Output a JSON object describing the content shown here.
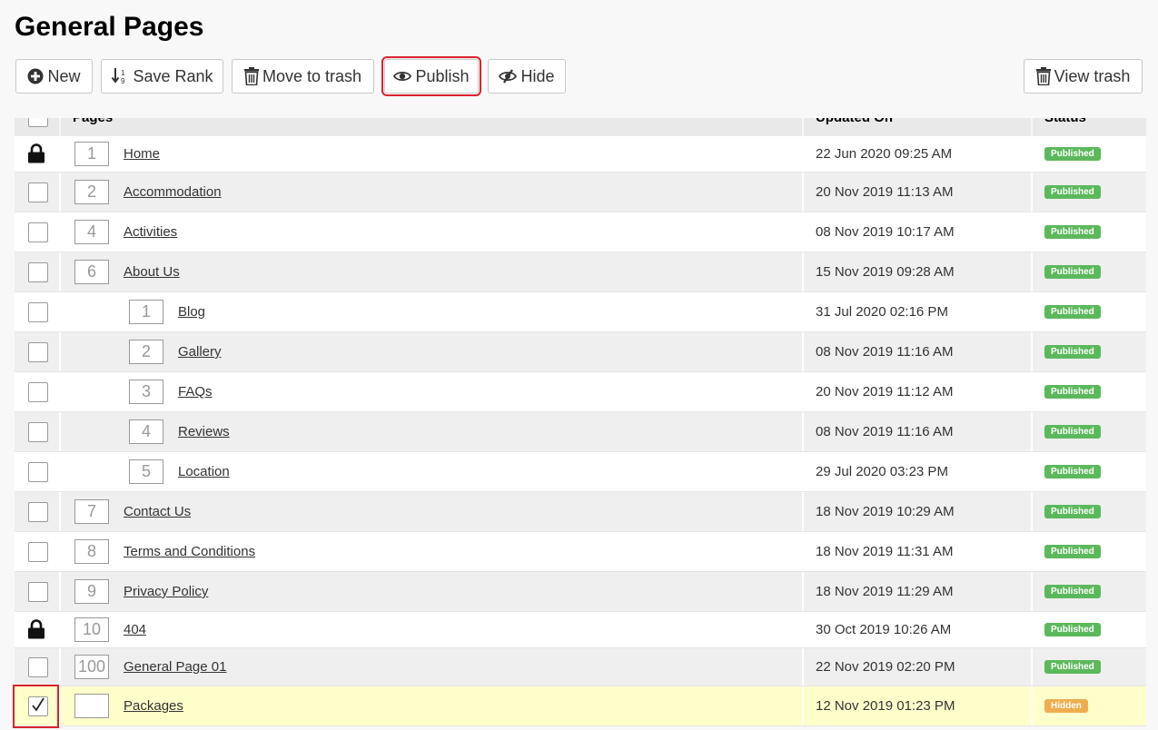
{
  "page_title": "General Pages",
  "toolbar": {
    "new_label": "New",
    "save_rank_label": "Save Rank",
    "move_to_trash_label": "Move to trash",
    "publish_label": "Publish",
    "hide_label": "Hide",
    "view_trash_label": "View trash"
  },
  "table": {
    "headers": {
      "pages": "Pages",
      "updated_on": "Updated On",
      "status": "Status"
    },
    "rows": [
      {
        "locked": true,
        "checked": false,
        "rank": "1",
        "title": "Home",
        "indent": false,
        "updated": "22 Jun 2020 09:25 AM",
        "status": "Published"
      },
      {
        "locked": false,
        "checked": false,
        "rank": "2",
        "title": "Accommodation",
        "indent": false,
        "updated": "20 Nov 2019 11:13 AM",
        "status": "Published"
      },
      {
        "locked": false,
        "checked": false,
        "rank": "4",
        "title": "Activities",
        "indent": false,
        "updated": "08 Nov 2019 10:17 AM",
        "status": "Published"
      },
      {
        "locked": false,
        "checked": false,
        "rank": "6",
        "title": "About Us",
        "indent": false,
        "updated": "15 Nov 2019 09:28 AM",
        "status": "Published"
      },
      {
        "locked": false,
        "checked": false,
        "rank": "1",
        "title": "Blog",
        "indent": true,
        "updated": "31 Jul 2020 02:16 PM",
        "status": "Published"
      },
      {
        "locked": false,
        "checked": false,
        "rank": "2",
        "title": "Gallery",
        "indent": true,
        "updated": "08 Nov 2019 11:16 AM",
        "status": "Published"
      },
      {
        "locked": false,
        "checked": false,
        "rank": "3",
        "title": "FAQs",
        "indent": true,
        "updated": "20 Nov 2019 11:12 AM",
        "status": "Published"
      },
      {
        "locked": false,
        "checked": false,
        "rank": "4",
        "title": "Reviews",
        "indent": true,
        "updated": "08 Nov 2019 11:16 AM",
        "status": "Published"
      },
      {
        "locked": false,
        "checked": false,
        "rank": "5",
        "title": "Location",
        "indent": true,
        "updated": "29 Jul 2020 03:23 PM",
        "status": "Published"
      },
      {
        "locked": false,
        "checked": false,
        "rank": "7",
        "title": "Contact Us",
        "indent": false,
        "updated": "18 Nov 2019 10:29 AM",
        "status": "Published"
      },
      {
        "locked": false,
        "checked": false,
        "rank": "8",
        "title": "Terms and Conditions",
        "indent": false,
        "updated": "18 Nov 2019 11:31 AM",
        "status": "Published"
      },
      {
        "locked": false,
        "checked": false,
        "rank": "9",
        "title": "Privacy Policy",
        "indent": false,
        "updated": "18 Nov 2019 11:29 AM",
        "status": "Published"
      },
      {
        "locked": true,
        "checked": false,
        "rank": "10",
        "title": "404",
        "indent": false,
        "updated": "30 Oct 2019 10:26 AM",
        "status": "Published"
      },
      {
        "locked": false,
        "checked": false,
        "rank": "100",
        "title": "General Page 01",
        "indent": false,
        "updated": "22 Nov 2019 02:20 PM",
        "status": "Published"
      },
      {
        "locked": false,
        "checked": true,
        "rank": "",
        "title": "Packages",
        "indent": false,
        "updated": "12 Nov 2019 01:23 PM",
        "status": "Hidden"
      }
    ]
  },
  "icons": {
    "new": "plus-circle-icon",
    "save_rank": "sort-numeric-icon",
    "trash": "trash-icon",
    "publish": "eye-icon",
    "hide": "eye-slash-icon",
    "lock": "lock-icon",
    "check": "checkmark-icon"
  },
  "colors": {
    "published": "#5cb85c",
    "hidden": "#f0ad4e",
    "highlight_row": "#ffffcc",
    "annotation_red": "#d9232d"
  }
}
